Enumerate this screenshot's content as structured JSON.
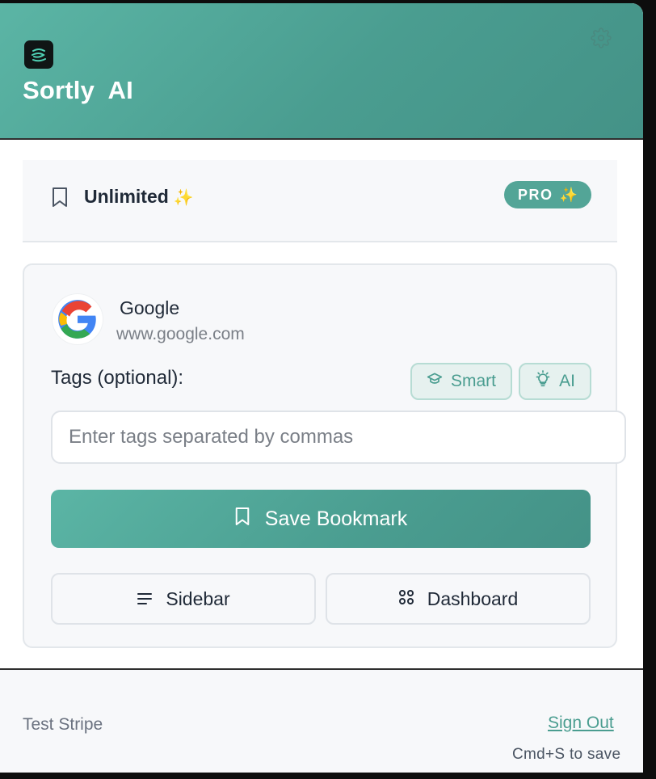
{
  "header": {
    "title": "Sortly  AI",
    "logo_icon": "app-logo-icon",
    "settings_icon": "gear-icon"
  },
  "plan": {
    "icon": "bookmark-icon",
    "label": "Unlimited",
    "sparkle": "✨",
    "badge_text": "PRO",
    "badge_sparkle": "✨"
  },
  "page": {
    "favicon": "google-icon",
    "site_name": "Google",
    "site_url": "www.google.com"
  },
  "tags": {
    "label": "Tags (optional):",
    "smart_label": "Smart",
    "smart_icon": "graduation-cap-icon",
    "ai_label": "AI",
    "ai_icon": "lightbulb-icon",
    "placeholder": "Enter tags separated by commas",
    "value": ""
  },
  "actions": {
    "save_label": "Save Bookmark",
    "save_icon": "bookmark-icon",
    "sidebar_label": "Sidebar",
    "sidebar_icon": "menu-lines-icon",
    "dashboard_label": "Dashboard",
    "dashboard_icon": "grid-icon"
  },
  "footer": {
    "account_text": "Test Stripe",
    "sign_out_label": "Sign Out",
    "shortcut_hint": "Cmd+S to save"
  },
  "colors": {
    "brand": "#4a9d90",
    "brand_light": "#5bb5a5",
    "chip_bg": "#e6f1ef",
    "surface": "#f7f8fa",
    "text": "#1f2937",
    "muted": "#7a7f87"
  }
}
